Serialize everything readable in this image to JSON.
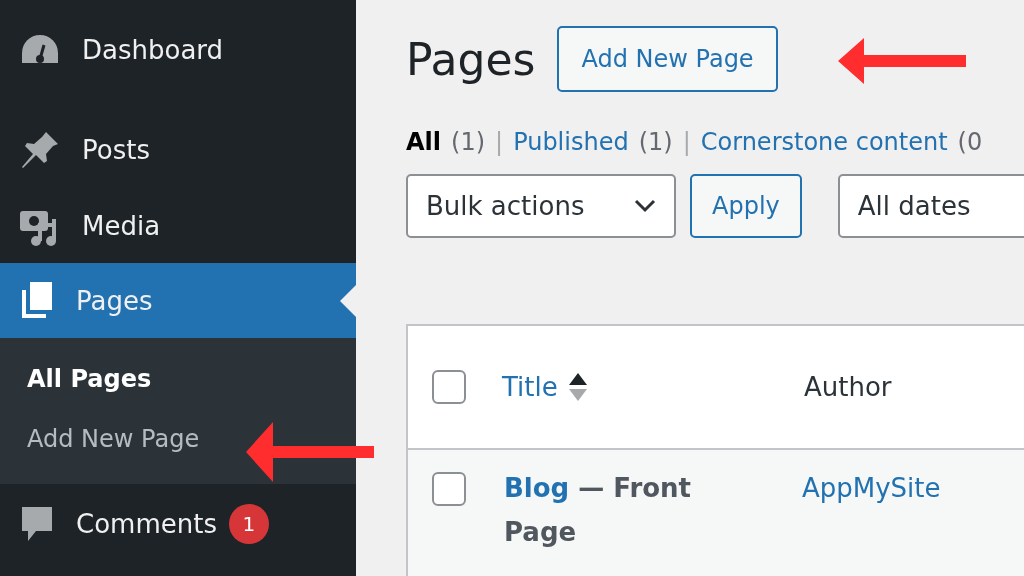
{
  "sidebar": {
    "items": [
      {
        "label": "Dashboard",
        "selected": false
      },
      {
        "label": "Posts",
        "selected": false
      },
      {
        "label": "Media",
        "selected": false
      },
      {
        "label": "Pages",
        "selected": true,
        "children": [
          {
            "label": "All Pages",
            "selected": true
          },
          {
            "label": "Add New Page",
            "selected": false
          }
        ]
      },
      {
        "label": "Comments",
        "selected": false,
        "badge": "1"
      }
    ]
  },
  "header": {
    "title": "Pages",
    "button": "Add New Page"
  },
  "filters": [
    {
      "label": "All",
      "count": "(1)",
      "selected": true
    },
    {
      "separator": "|",
      "label": "Published",
      "count": "(1)",
      "selected": false
    },
    {
      "separator": "|",
      "label": "Cornerstone content",
      "count": "(0",
      "selected": false
    }
  ],
  "toolbar": {
    "bulk_actions": "Bulk actions",
    "apply": "Apply",
    "dates": "All dates"
  },
  "table": {
    "columns": [
      "Title",
      "Author"
    ],
    "header_checked": false,
    "rows": [
      {
        "title": "Blog",
        "state": "— Front Page",
        "author": "AppMySite",
        "checked": false
      }
    ]
  }
}
